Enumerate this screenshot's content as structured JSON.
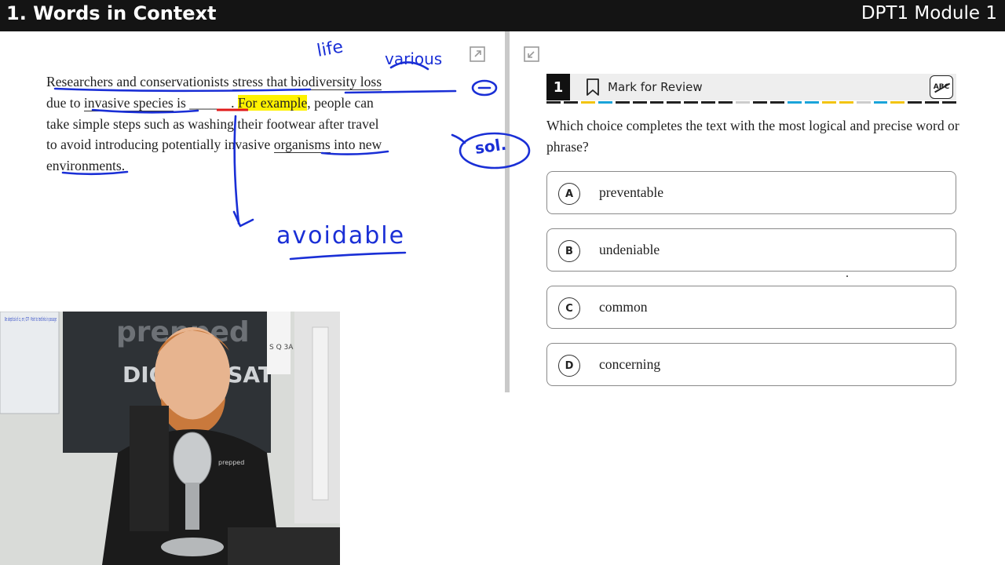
{
  "header": {
    "title": "1. Words in Context",
    "module": "DPT1 Module 1"
  },
  "passage": {
    "line1": {
      "pre": "Researchers and conservationists ",
      "u1": "stress",
      "mid": " that ",
      "u2": "biodiversity loss"
    },
    "line2": {
      "pre": "due to ",
      "u1": "invasive species",
      "mid": " is ",
      "blank": "______",
      "dot": ". ",
      "hl": "For example",
      "post": ", people can"
    },
    "line3": "take simple steps such as washing their footwear after travel",
    "line4": {
      "pre": "to avoid introducing potentially invasive ",
      "u1": "organisms",
      "post": " into new"
    },
    "line5": {
      "pre": "environments",
      "post": "."
    }
  },
  "annotations": {
    "life": "life",
    "various": "various",
    "sol": "sol.",
    "avoidable": "avoidable"
  },
  "question": {
    "number": "1",
    "mark_label": "Mark for Review",
    "abc_label": "ABC",
    "prompt": "Which choice completes the text with the most logical and precise word or phrase?",
    "choices": [
      {
        "letter": "A",
        "text": "preventable"
      },
      {
        "letter": "B",
        "text": "undeniable"
      },
      {
        "letter": "C",
        "text": "common"
      },
      {
        "letter": "D",
        "text": "concerning"
      }
    ]
  },
  "colors": {
    "ink_blue": "#1a2fd6",
    "ink_red": "#e01b1b",
    "highlight": "#fff200",
    "dash_colors": [
      "#222222",
      "#222222",
      "#f2c40f",
      "#1aa3d9",
      "#222222",
      "#222222",
      "#222222",
      "#222222",
      "#222222",
      "#222222",
      "#222222",
      "#cccccc",
      "#222222",
      "#222222",
      "#1aa3d9",
      "#1aa3d9",
      "#f2c40f",
      "#f2c40f",
      "#cccccc",
      "#1aa3d9",
      "#f2c40f",
      "#222222",
      "#222222",
      "#222222"
    ]
  },
  "webcam": {
    "wall_sign_big": "prepped",
    "wall_sign_line": "DIGITAL SAT",
    "whiteboard_notes": "Be skeptical of cc, err, GTF · Point to textlinks in passage",
    "shirt_logo": "prepped",
    "board_letters": "S Q 3A"
  }
}
